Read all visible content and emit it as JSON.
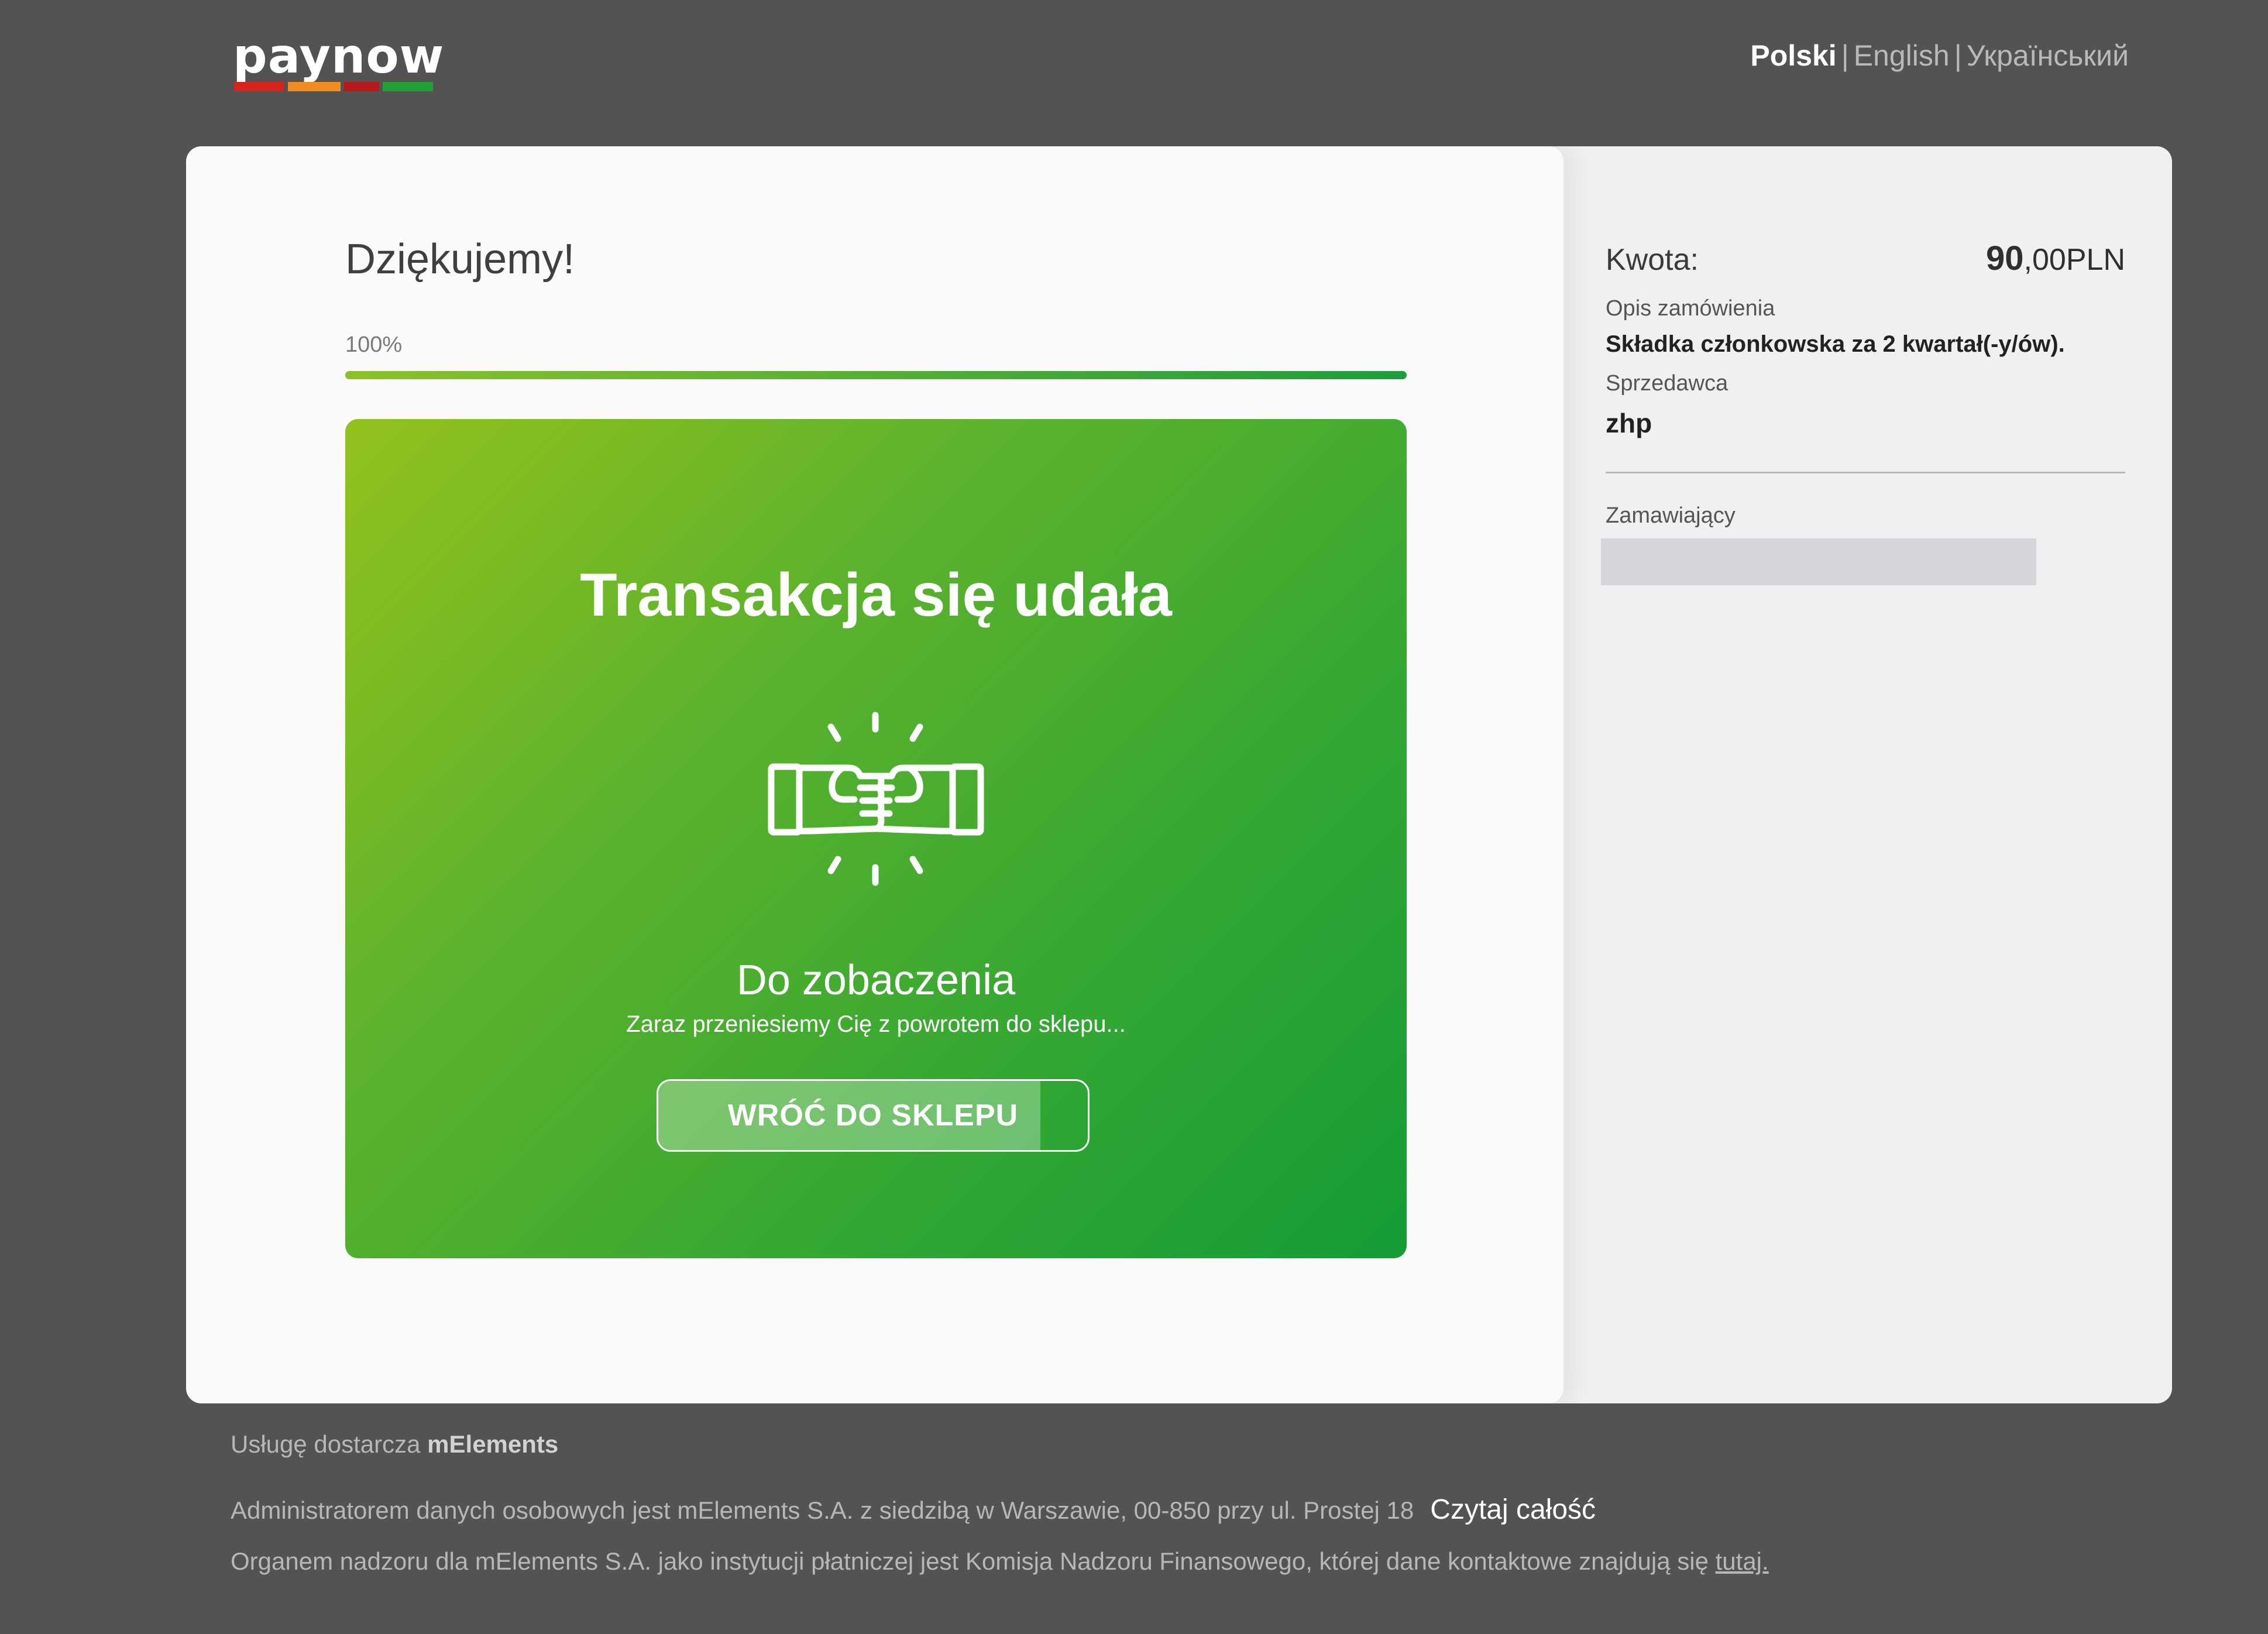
{
  "header": {
    "logo_text": "paynow",
    "logo_bar_colors": [
      "#d9211e",
      "#f28c1e",
      "#b8171b",
      "#23a036"
    ],
    "languages": [
      {
        "label": "Polski",
        "active": true
      },
      {
        "label": "English",
        "active": false
      },
      {
        "label": "Український",
        "active": false
      }
    ],
    "separator": "|"
  },
  "main": {
    "heading": "Dziękujemy!",
    "progress": {
      "percent_label": "100%",
      "value": 1.0
    },
    "result": {
      "title": "Transakcja się udała",
      "icon": "fist-bump-icon",
      "subtitle": "Do zobaczenia",
      "message": "Zaraz przeniesiemy Cię z powrotem do sklepu...",
      "button_label": "WRÓĆ DO SKLEPU",
      "button_countdown_fraction": 0.89
    }
  },
  "summary": {
    "amount_label": "Kwota:",
    "amount_integer": "90",
    "amount_fraction": ",00PLN",
    "description_label": "Opis zamówienia",
    "description_value": "Składka członkowska za 2 kwartał(-y/ów).",
    "seller_label": "Sprzedawca",
    "seller_value": "zhp",
    "orderer_label": "Zamawiający"
  },
  "footer": {
    "provider_prefix": "Usługę dostarcza",
    "provider_name": "mElements",
    "admin_text": "Administratorem danych osobowych jest mElements S.A. z siedzibą w Warszawie, 00-850 przy ul. Prostej 18",
    "read_all": "Czytaj całość",
    "supervision_text": "Organem nadzoru dla mElements S.A. jako instytucji płatniczej jest Komisja Nadzoru Finansowego, której dane kontaktowe znajdują się",
    "here_link": "tutaj."
  },
  "colors": {
    "background": "#545354",
    "success_green": "#33a733",
    "progress_green": "#1d9e3c"
  }
}
